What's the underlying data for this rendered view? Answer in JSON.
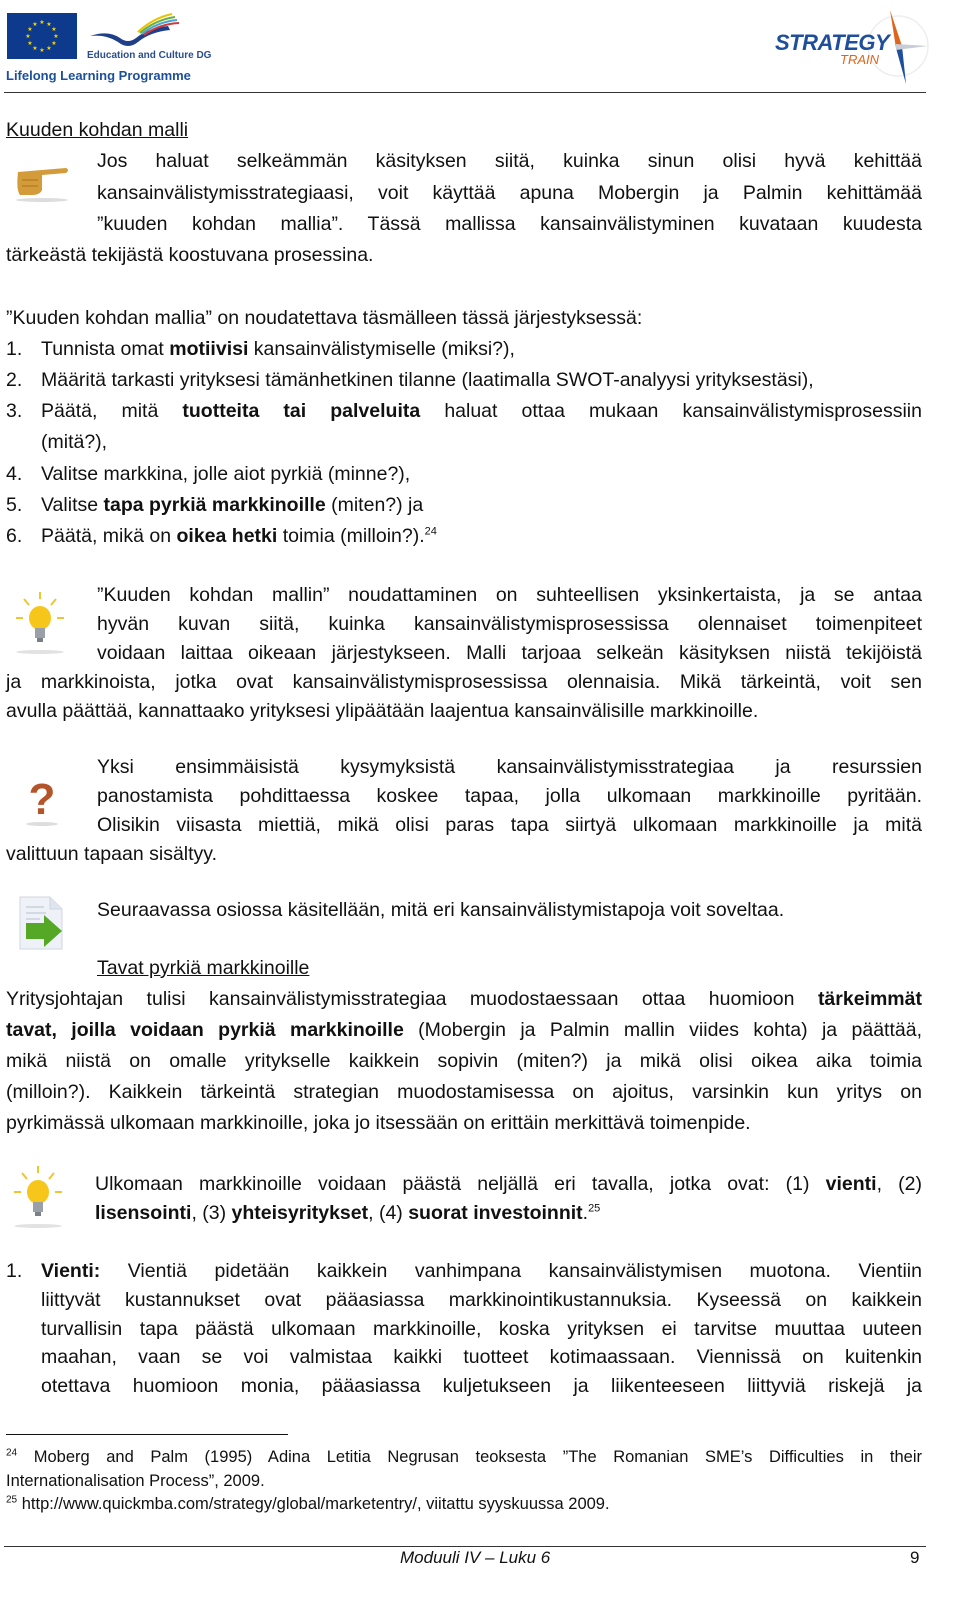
{
  "header": {
    "eu_programme_org": "Education and Culture DG",
    "eu_programme_name": "Lifelong Learning Programme",
    "project_logo_main": "STRATEGY",
    "project_logo_sub": "TRAIN"
  },
  "section1": {
    "heading": "Kuuden kohdan malli",
    "icon": "pointing-hand-icon",
    "intro_lines": [
      "Jos haluat selkeämmän käsityksen siitä, kuinka sinun olisi hyvä kehittää",
      "kansainvälistymisstrategiaasi, voit käyttää apuna Mobergin ja Palmin kehittämää",
      "”kuuden kohdan mallia”. Tässä mallissa kansainvälistyminen kuvataan kuudesta",
      "tärkeästä tekijästä koostuvana prosessina."
    ],
    "list_intro": "”Kuuden kohdan mallia” on noudatettava täsmälleen tässä järjestyksessä:",
    "steps": [
      {
        "num": "1.",
        "pre": "Tunnista omat ",
        "bold": "motiivisi",
        "post": " kansainvälistymiselle (miksi?),"
      },
      {
        "num": "2.",
        "pre": "Määritä tarkasti yrityksesi tämänhetkinen tilanne (laatimalla SWOT-analyysi yrityksestäsi),",
        "bold": "",
        "post": ""
      },
      {
        "num": "3.",
        "pre": "Päätä, mitä ",
        "bold": "tuotteita tai palveluita",
        "post": " haluat ottaa mukaan kansainvälistymisprosessiin",
        "cont": "(mitä?),"
      },
      {
        "num": "4.",
        "pre": "Valitse markkina, jolle aiot pyrkiä (minne?),",
        "bold": "",
        "post": ""
      },
      {
        "num": "5.",
        "pre": "Valitse ",
        "bold": "tapa pyrkiä markkinoille",
        "post": " (miten?) ja"
      },
      {
        "num": "6.",
        "pre": "Päätä, mikä on ",
        "bold": "oikea hetki",
        "post": " toimia (milloin?).",
        "sup": "24"
      }
    ]
  },
  "tip1": {
    "icon": "lightbulb-icon",
    "lines": [
      "”Kuuden kohdan mallin” noudattaminen on suhteellisen yksinkertaista, ja se antaa",
      "hyvän kuvan siitä, kuinka kansainvälistymisprosessissa olennaiset toimenpiteet",
      "voidaan laittaa oikeaan järjestykseen. Malli tarjoaa selkeän käsityksen niistä tekijöistä",
      "ja markkinoista, jotka ovat kansainvälistymisprosessissa olennaisia. Mikä tärkeintä, voit sen",
      "avulla päättää, kannattaako yrityksesi ylipäätään laajentua kansainvälisille markkinoille."
    ]
  },
  "question1": {
    "icon": "question-mark-icon",
    "lines": [
      "Yksi ensimmäisistä kysymyksistä kansainvälistymisstrategiaa ja resurssien",
      "panostamista pohdittaessa koskee tapaa, jolla ulkomaan markkinoille pyritään.",
      "Olisikin viisasta miettiä, mikä olisi paras tapa siirtyä ulkomaan markkinoille ja mitä",
      "valittuun tapaan sisältyy."
    ]
  },
  "next1": {
    "icon": "next-document-arrow-icon",
    "text": "Seuraavassa osiossa käsitellään, mitä eri kansainvälistymistapoja voit soveltaa."
  },
  "section2": {
    "heading": "Tavat pyrkiä markkinoille",
    "p1_line1_pre": "Yritysjohtajan tulisi kansainvälistymisstrategiaa muodostaessaan ottaa huomioon ",
    "p1_line1_bold": "tärkeimmät",
    "p1_line2_bold": "tavat, joilla voidaan pyrkiä markkinoille",
    "p1_line2_post": " (Mobergin ja Palmin mallin viides kohta) ja päättää,",
    "p1_lines_rest": [
      "mikä niistä on omalle yritykselle kaikkein sopivin (miten?) ja mikä olisi oikea aika toimia",
      "(milloin?). Kaikkein tärkeintä strategian muodostamisessa on ajoitus, varsinkin kun yritys on",
      "pyrkimässä ulkomaan markkinoille, joka jo itsessään on erittäin merkittävä toimenpide."
    ]
  },
  "tip2": {
    "icon": "lightbulb-icon",
    "l1_pre": "Ulkomaan markkinoille voidaan päästä neljällä eri tavalla, jotka ovat: (1) ",
    "l1_b1": "vienti",
    "l1_post": ", (2)",
    "l2_b1": "lisensointi",
    "l2_t1": ", (3) ",
    "l2_b2": "yhteisyritykset",
    "l2_t2": ", (4) ",
    "l2_b3": "suorat investoinnit",
    "l2_t3": ".",
    "l2_sup": "25"
  },
  "entry_modes": {
    "item1_num": "1.",
    "item1_title": "Vienti:",
    "item1_line1": " Vientiä pidetään kaikkein vanhimpana kansainvälistymisen muotona. Vientiin",
    "item1_lines": [
      "liittyvät kustannukset ovat pääasiassa markkinointikustannuksia. Kyseessä on kaikkein",
      "turvallisin tapa päästä ulkomaan markkinoille, koska yrityksen ei tarvitse muuttaa uuteen",
      "maahan, vaan se voi valmistaa kaikki tuotteet kotimaassaan. Viennissä on kuitenkin",
      "otettava huomioon monia, pääasiassa kuljetukseen ja liikenteeseen liittyviä riskejä ja"
    ]
  },
  "footnotes": [
    {
      "num": "24",
      "line1": "Moberg and Palm (1995) Adina Letitia Negrusan teoksesta ”The Romanian SME’s Difficulties in their",
      "line2": "Internationalisation Process”, 2009."
    },
    {
      "num": "25",
      "line1": "http://www.quickmba.com/strategy/global/marketentry/, viitattu syyskuussa 2009."
    }
  ],
  "footer": {
    "module": "Moduuli IV – Luku 6",
    "page_number": "9"
  }
}
